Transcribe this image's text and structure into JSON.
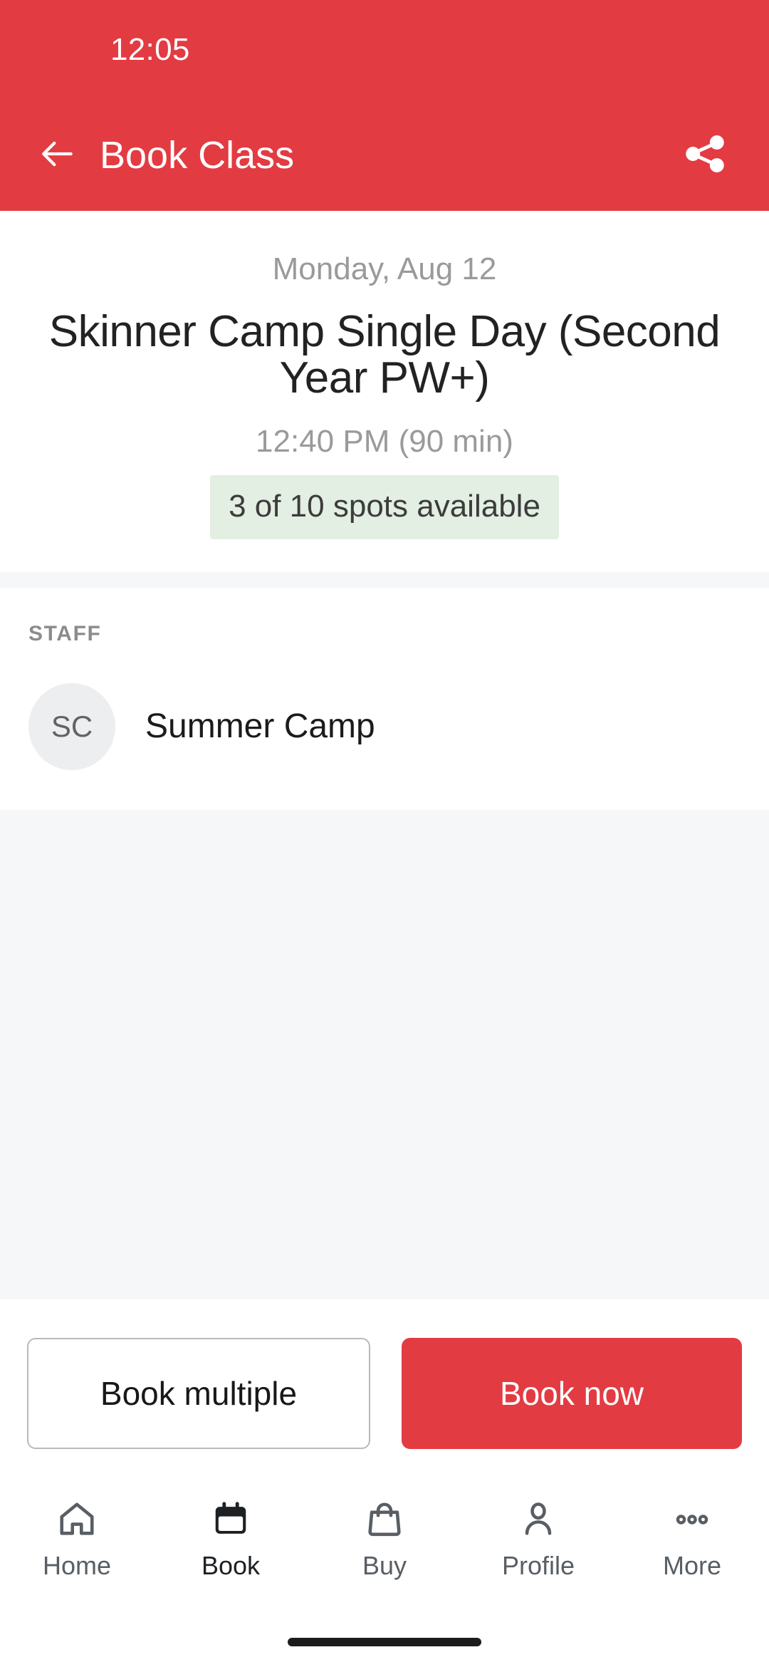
{
  "status_bar": {
    "time": "12:05"
  },
  "header": {
    "title": "Book Class",
    "back_icon": "arrow-left-icon",
    "share_icon": "share-icon",
    "background_color": "#E33B42"
  },
  "class_info": {
    "date": "Monday, Aug 12",
    "title": "Skinner Camp Single Day (Second Year PW+)",
    "time": "12:40 PM (90 min)",
    "spots_badge": "3 of 10 spots available",
    "spots_badge_bg": "#E2EFE2",
    "spots_total": 10,
    "spots_available": 3,
    "duration_minutes": 90
  },
  "staff": {
    "section_label": "STAFF",
    "members": [
      {
        "initials": "SC",
        "name": "Summer Camp"
      }
    ]
  },
  "actions": {
    "secondary_label": "Book multiple",
    "primary_label": "Book now",
    "primary_color": "#E33B42"
  },
  "bottom_nav": {
    "items": [
      {
        "label": "Home",
        "icon": "home-icon",
        "active": false
      },
      {
        "label": "Book",
        "icon": "calendar-icon",
        "active": true
      },
      {
        "label": "Buy",
        "icon": "bag-icon",
        "active": false
      },
      {
        "label": "Profile",
        "icon": "person-icon",
        "active": false
      },
      {
        "label": "More",
        "icon": "dots-icon",
        "active": false
      }
    ]
  }
}
